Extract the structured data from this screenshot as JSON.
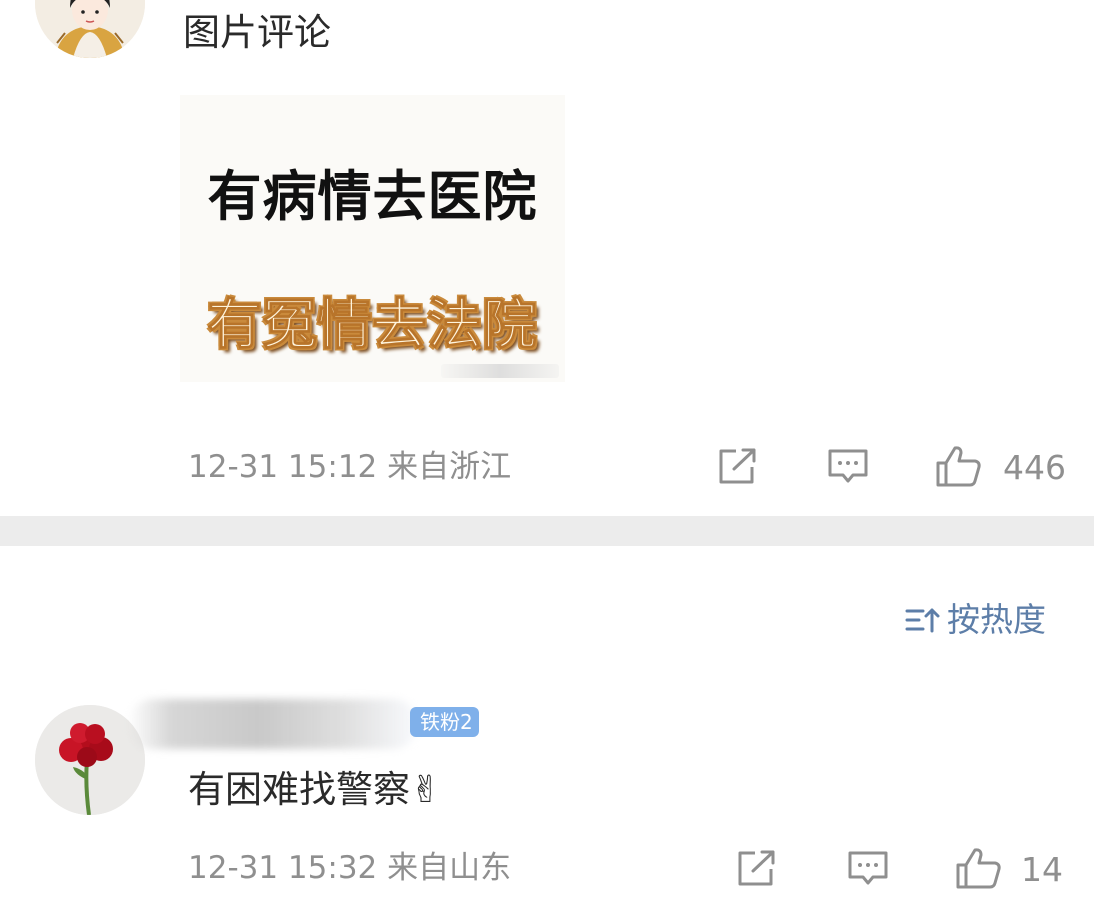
{
  "comment1": {
    "text": "图片评论",
    "image_lines": [
      "有病情去医院",
      "有冤情去法院"
    ],
    "time": "12-31 15:12",
    "location": "来自浙江",
    "likes": "446"
  },
  "sort": {
    "label": "按热度"
  },
  "comment2": {
    "badge": "铁粉2",
    "text": "有困难找警察✌",
    "time": "12-31 15:32",
    "location": "来自山东",
    "likes": "14"
  },
  "icons": [
    "share-icon",
    "comment-icon",
    "like-icon",
    "sort-icon"
  ],
  "colors": {
    "meta": "#8f8f8f",
    "sort": "#5d7ea8",
    "badge": "#7fb0ea",
    "divider": "#ececec"
  }
}
